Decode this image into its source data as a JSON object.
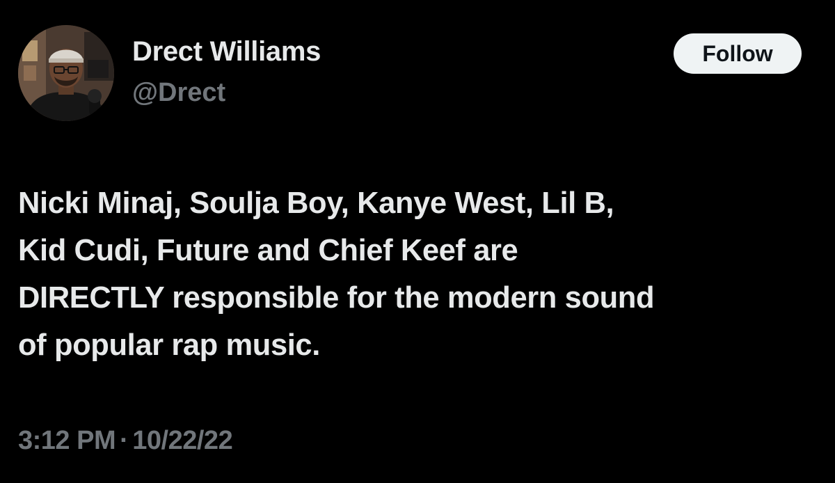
{
  "author": {
    "display_name": "Drect Williams",
    "handle": "@Drect"
  },
  "follow_button": {
    "label": "Follow"
  },
  "tweet": {
    "lines": [
      "Nicki Minaj, Soulja Boy, Kanye West, Lil B,",
      "Kid Cudi, Future and Chief Keef are",
      "DIRECTLY responsible for the modern sound",
      "of popular rap music."
    ]
  },
  "meta": {
    "time": "3:12 PM",
    "separator": "·",
    "date": "10/22/22"
  },
  "colors": {
    "background": "#000000",
    "primary_text": "#e7e9ea",
    "secondary_text": "#71767b",
    "follow_button_bg": "#eff3f4",
    "follow_button_text": "#0f1419"
  }
}
